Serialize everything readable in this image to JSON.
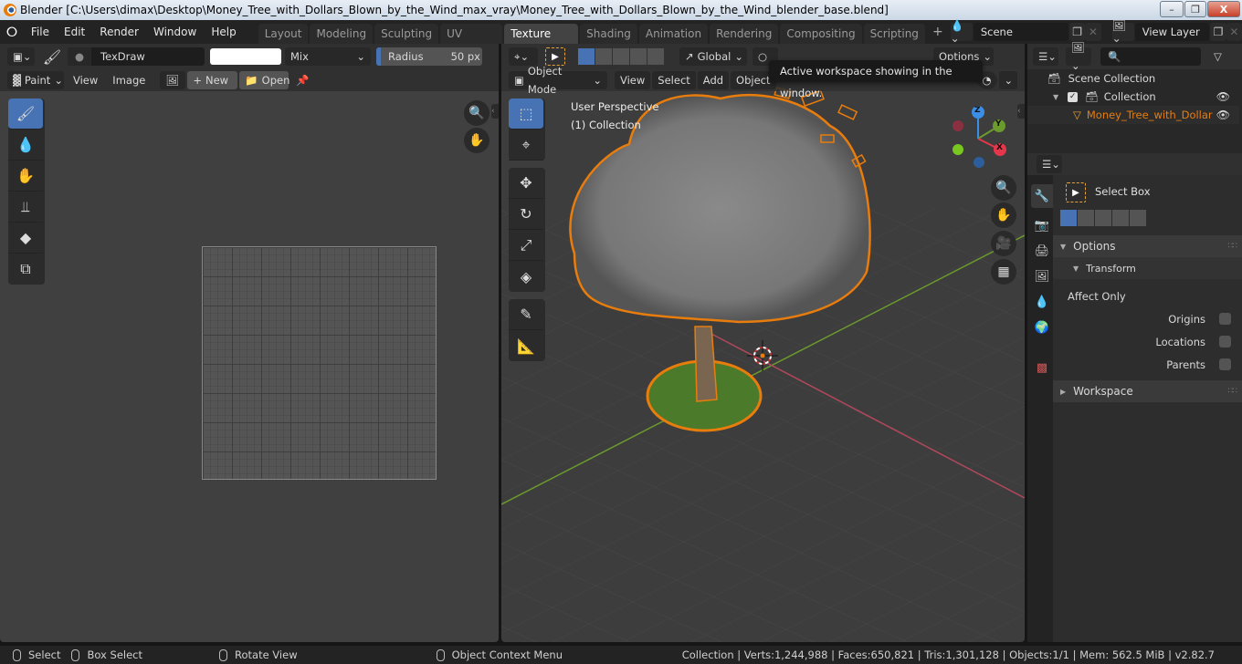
{
  "window": {
    "title": "Blender [C:\\Users\\dimax\\Desktop\\Money_Tree_with_Dollars_Blown_by_the_Wind_max_vray\\Money_Tree_with_Dollars_Blown_by_the_Wind_blender_base.blend]",
    "minimize": "–",
    "maximize": "❐",
    "close": "X"
  },
  "menu": [
    "File",
    "Edit",
    "Render",
    "Window",
    "Help"
  ],
  "workspaces": [
    {
      "label": "Layout",
      "active": false
    },
    {
      "label": "Modeling",
      "active": false
    },
    {
      "label": "Sculpting",
      "active": false
    },
    {
      "label": "UV Editing",
      "active": false
    },
    {
      "label": "Texture Paint",
      "active": true
    },
    {
      "label": "Shading",
      "active": false
    },
    {
      "label": "Animation",
      "active": false
    },
    {
      "label": "Rendering",
      "active": false
    },
    {
      "label": "Compositing",
      "active": false
    },
    {
      "label": "Scripting",
      "active": false
    }
  ],
  "add_workspace": "+",
  "scene": {
    "value": "Scene"
  },
  "view_layer": {
    "value": "View Layer"
  },
  "image_editor": {
    "brush_name": "TexDraw",
    "blend_mode": "Mix",
    "radius_label": "Radius",
    "radius_value": "50 px",
    "mode": "Paint",
    "view": "View",
    "image": "Image",
    "new": "New",
    "open": "Open",
    "color_hex": "#ffffff",
    "tools": [
      "draw-brush",
      "soften-brush",
      "smear-brush",
      "clone-brush",
      "fill-brush",
      "mask-brush"
    ]
  },
  "viewport": {
    "transform_orientation": "Global",
    "options": "Options",
    "mode": "Object Mode",
    "menus": [
      "View",
      "Select",
      "Add",
      "Object"
    ],
    "tooltip": "Active workspace showing in the window.",
    "overlay_line1": "User Perspective",
    "overlay_line2": "(1) Collection",
    "gizmo": {
      "x": "X",
      "y": "Y",
      "z": "Z",
      "x_color": "#e5374c",
      "y_color": "#6c9b2d",
      "z_color": "#3b8ee6"
    }
  },
  "outliner": {
    "search_placeholder": "",
    "scene_collection": "Scene Collection",
    "collection": "Collection",
    "object": "Money_Tree_with_Dollar",
    "object_color": "#e87d0d"
  },
  "properties": {
    "tool_name": "Select Box",
    "options": "Options",
    "transform": "Transform",
    "affect_only": "Affect Only",
    "origins": "Origins",
    "locations": "Locations",
    "parents": "Parents",
    "workspace": "Workspace"
  },
  "status": {
    "select": "Select",
    "box_select": "Box Select",
    "rotate_view": "Rotate View",
    "context_menu": "Object Context Menu",
    "stats": "Collection | Verts:1,244,988 | Faces:650,821 | Tris:1,301,128 | Objects:1/1 | Mem: 562.5 MiB | v2.82.7"
  }
}
